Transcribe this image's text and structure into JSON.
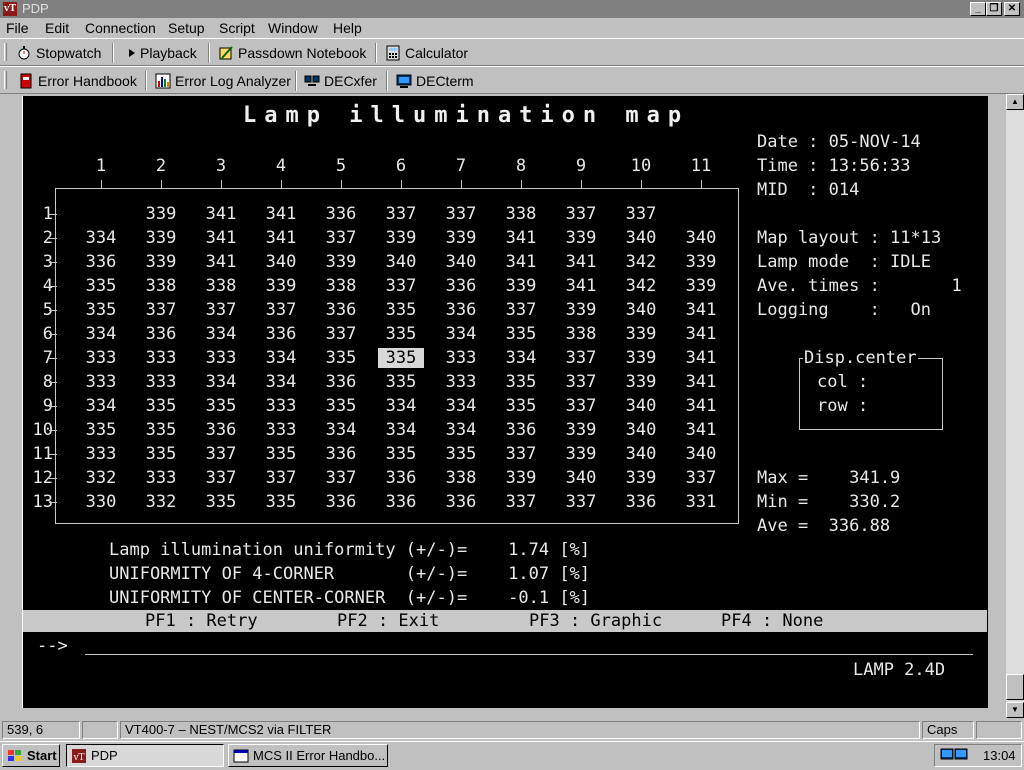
{
  "window": {
    "title": "PDP",
    "app_icon_glyph": "vT"
  },
  "menu": [
    "File",
    "Edit",
    "Connection",
    "Setup",
    "Script",
    "Window",
    "Help"
  ],
  "toolbar1": [
    {
      "label": "Stopwatch",
      "icon": "stopwatch-icon"
    },
    {
      "label": "Playback",
      "icon": "play-icon"
    },
    {
      "label": "Passdown Notebook",
      "icon": "notebook-icon"
    },
    {
      "label": "Calculator",
      "icon": "calculator-icon"
    }
  ],
  "toolbar2": [
    {
      "label": "Error Handbook",
      "icon": "handbook-icon"
    },
    {
      "label": "Error Log Analyzer",
      "icon": "analyzer-icon"
    },
    {
      "label": "DECxfer",
      "icon": "transfer-icon"
    },
    {
      "label": "DECterm",
      "icon": "terminal-icon"
    }
  ],
  "terminal": {
    "title": "Lamp illumination map",
    "columns": [
      "1",
      "2",
      "3",
      "4",
      "5",
      "6",
      "7",
      "8",
      "9",
      "10",
      "11"
    ],
    "rows": [
      {
        "label": "1",
        "values": [
          "",
          "339",
          "341",
          "341",
          "336",
          "337",
          "337",
          "338",
          "337",
          "337",
          ""
        ]
      },
      {
        "label": "2",
        "values": [
          "334",
          "339",
          "341",
          "341",
          "337",
          "339",
          "339",
          "341",
          "339",
          "340",
          "340"
        ]
      },
      {
        "label": "3",
        "values": [
          "336",
          "339",
          "341",
          "340",
          "339",
          "340",
          "340",
          "341",
          "341",
          "342",
          "339"
        ]
      },
      {
        "label": "4",
        "values": [
          "335",
          "338",
          "338",
          "339",
          "338",
          "337",
          "336",
          "339",
          "341",
          "342",
          "339"
        ]
      },
      {
        "label": "5",
        "values": [
          "335",
          "337",
          "337",
          "337",
          "336",
          "335",
          "336",
          "337",
          "339",
          "340",
          "341"
        ]
      },
      {
        "label": "6",
        "values": [
          "334",
          "336",
          "334",
          "336",
          "337",
          "335",
          "334",
          "335",
          "338",
          "339",
          "341"
        ]
      },
      {
        "label": "7",
        "values": [
          "333",
          "333",
          "333",
          "334",
          "335",
          "335",
          "333",
          "334",
          "337",
          "339",
          "341"
        ]
      },
      {
        "label": "8",
        "values": [
          "333",
          "333",
          "334",
          "334",
          "336",
          "335",
          "333",
          "335",
          "337",
          "339",
          "341"
        ]
      },
      {
        "label": "9",
        "values": [
          "334",
          "335",
          "335",
          "333",
          "335",
          "334",
          "334",
          "335",
          "337",
          "340",
          "341"
        ]
      },
      {
        "label": "10",
        "values": [
          "335",
          "335",
          "336",
          "333",
          "334",
          "334",
          "334",
          "336",
          "339",
          "340",
          "341"
        ]
      },
      {
        "label": "11",
        "values": [
          "333",
          "335",
          "337",
          "335",
          "336",
          "335",
          "335",
          "337",
          "339",
          "340",
          "340"
        ]
      },
      {
        "label": "12",
        "values": [
          "332",
          "333",
          "337",
          "337",
          "337",
          "336",
          "338",
          "339",
          "340",
          "339",
          "337"
        ]
      },
      {
        "label": "13",
        "values": [
          "330",
          "332",
          "335",
          "335",
          "336",
          "336",
          "336",
          "337",
          "337",
          "336",
          "331"
        ]
      }
    ],
    "selected_cell": {
      "row": 7,
      "col": 6
    },
    "info": {
      "date": "Date : 05-NOV-14",
      "time": "Time : 13:56:33",
      "mid": "MID  : 014",
      "map_layout": "Map layout : 11*13",
      "lamp_mode": "Lamp mode  : IDLE",
      "ave_times": "Ave. times :       1",
      "logging": "Logging    :   On"
    },
    "disp_center": {
      "title": "Disp.center",
      "col": "col :",
      "row": "row :"
    },
    "stats": {
      "max": "Max =    341.9",
      "min": "Min =    330.2",
      "ave": "Ave =  336.88"
    },
    "uniformity": [
      "Lamp illumination uniformity (+/-)=    1.74 [%]",
      "UNIFORMITY OF 4-CORNER       (+/-)=    1.07 [%]",
      "UNIFORMITY OF CENTER-CORNER  (+/-)=    -0.1 [%]"
    ],
    "pf_keys": [
      "PF1 : Retry",
      "PF2 : Exit",
      "PF3 : Graphic",
      "PF4 : None"
    ],
    "prompt": "-->",
    "version": "LAMP 2.4D"
  },
  "statusbar": {
    "cursor": "539, 6",
    "connection": "VT400-7 – NEST/MCS2 via FILTER",
    "caps": "Caps"
  },
  "taskbar": {
    "start": "Start",
    "tasks": [
      "PDP",
      "MCS II Error Handbo..."
    ],
    "clock": "13:04"
  },
  "colors": {
    "terminal_bg": "#000000",
    "terminal_fg": "#e8e8e8",
    "chrome": "#c0c0c0",
    "titlebar": "#808080"
  }
}
